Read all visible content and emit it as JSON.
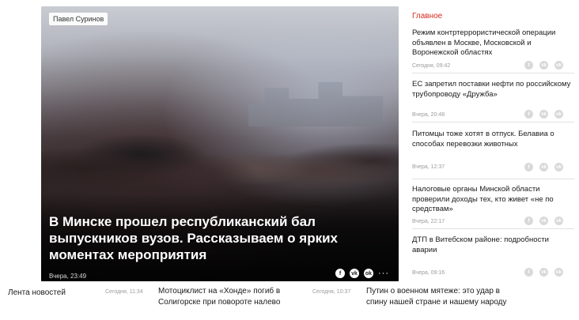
{
  "hero": {
    "photo_credit": "Павел Суринов",
    "title": "В Минске прошел республиканский бал выпускников вузов. Рассказываем о ярких моментах мероприятия",
    "time": "Вчера, 23:49",
    "share": {
      "facebook": "f",
      "vk": "vk",
      "ok": "ok",
      "more": "···"
    }
  },
  "sidebar": {
    "title": "Главное",
    "items": [
      {
        "text": "Режим контртеррористической операции объявлен в Москве, Московской и Воронежской областях",
        "time": "Сегодня, 09:42"
      },
      {
        "text": "ЕС запретил поставки нефти по российскому трубопроводу «Дружба»",
        "time": "Вчера, 20:48"
      },
      {
        "text": "Питомцы тоже хотят в отпуск. Белавиа о способах перевозки животных",
        "time": "Вчера, 12:37"
      },
      {
        "text": "Налоговые органы Минской области проверили доходы тех, кто живет «не по средствам»",
        "time": "Вчера, 22:17"
      },
      {
        "text": "ДТП в Витебском районе: подробности аварии",
        "time": "Вчера, 09:16"
      }
    ]
  },
  "bottom": {
    "feed_label": "Лента новостей",
    "items": [
      {
        "time": "Сегодня, 11:34",
        "text": "Мотоциклист на «Хонде» погиб в Солигорске при повороте налево"
      },
      {
        "time": "Сегодня, 10:37",
        "text": "Путин о военном мятеже: это удар в спину нашей стране и нашему народу"
      }
    ]
  },
  "colors": {
    "accent": "#d52a1e",
    "meta": "#9b9b9b",
    "divider": "#e2e2e2"
  }
}
